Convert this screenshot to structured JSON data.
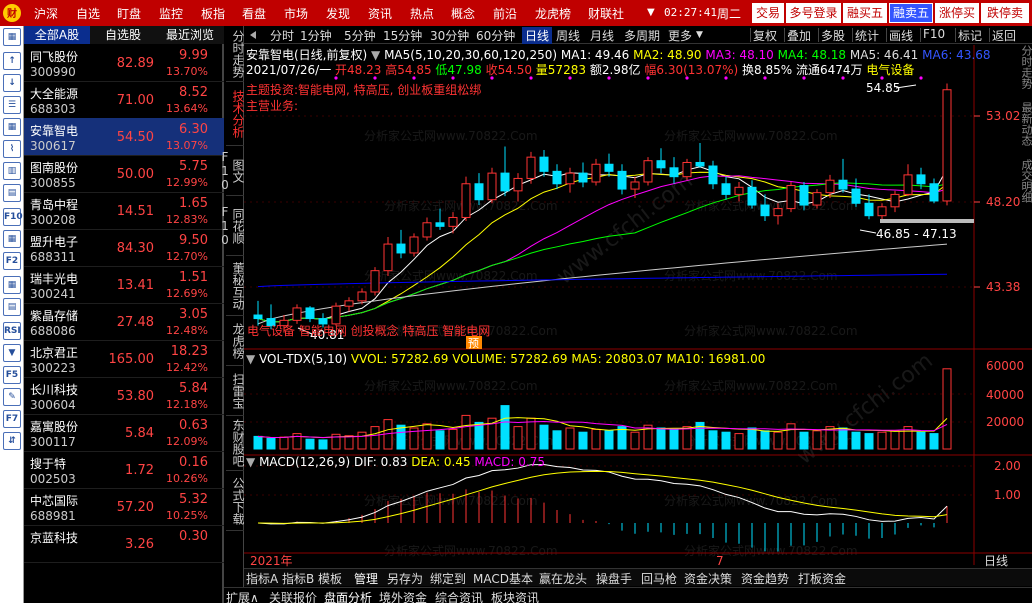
{
  "top_menu": {
    "items": [
      "沪深",
      "自选",
      "盯盘",
      "监控",
      "板指",
      "看盘",
      "市场",
      "发现",
      "资讯",
      "热点",
      "概念",
      "前沿",
      "龙虎榜",
      "财联社"
    ],
    "dropdown_arrow": "▼",
    "clock": "02:27:41",
    "weekday": "周二",
    "buttons": [
      "交易",
      "多号登录",
      "融买五",
      "融卖五",
      "涨停买",
      "跌停卖"
    ]
  },
  "left_icons": [
    "grid-icon",
    "arrow-up-icon",
    "arrow-down-icon",
    "list-icon",
    "grid2-icon",
    "line-chart-icon",
    "candle-icon",
    "bars-icon",
    "f10-icon",
    "grid3-icon",
    "f2-icon",
    "grid4-icon",
    "doc-icon",
    "rsi-icon",
    "flag-icon",
    "f5-icon",
    "pencil-icon",
    "f7-icon",
    "arrow-icon"
  ],
  "left_icon_labels": [
    "▦",
    "↑",
    "↓",
    "☰",
    "▦",
    "⌇",
    "▥",
    "▤",
    "F10",
    "▦",
    "F2",
    "▦",
    "▤",
    "RSI",
    "▼",
    "F5",
    "✎",
    "F7",
    "⇵"
  ],
  "stock_list": {
    "tabs": [
      "全部A股",
      "自选股",
      "最近浏览"
    ],
    "rows": [
      {
        "name": "同飞股份",
        "code": "300990",
        "price": "82.89",
        "change": "9.99",
        "pct": "13.70%"
      },
      {
        "name": "大全能源",
        "code": "688303",
        "price": "71.00",
        "change": "8.52",
        "pct": "13.64%"
      },
      {
        "name": "安靠智电",
        "code": "300617",
        "price": "54.50",
        "change": "6.30",
        "pct": "13.07%"
      },
      {
        "name": "图南股份",
        "code": "300855",
        "price": "50.00",
        "change": "5.75",
        "pct": "12.99%"
      },
      {
        "name": "青岛中程",
        "code": "300208",
        "price": "14.51",
        "change": "1.65",
        "pct": "12.83%"
      },
      {
        "name": "盟升电子",
        "code": "688311",
        "price": "84.30",
        "change": "9.50",
        "pct": "12.70%"
      },
      {
        "name": "瑞丰光电",
        "code": "300241",
        "price": "13.41",
        "change": "1.51",
        "pct": "12.69%"
      },
      {
        "name": "紫晶存储",
        "code": "688086",
        "price": "27.48",
        "change": "3.05",
        "pct": "12.48%"
      },
      {
        "name": "北京君正",
        "code": "300223",
        "price": "165.00",
        "change": "18.23",
        "pct": "12.42%"
      },
      {
        "name": "长川科技",
        "code": "300604",
        "price": "53.80",
        "change": "5.84",
        "pct": "12.18%"
      },
      {
        "name": "嘉寓股份",
        "code": "300117",
        "price": "5.84",
        "change": "0.63",
        "pct": "12.09%"
      },
      {
        "name": "搜于特",
        "code": "002503",
        "price": "1.72",
        "change": "0.16",
        "pct": "10.26%"
      },
      {
        "name": "中芯国际",
        "code": "688981",
        "price": "57.20",
        "change": "5.32",
        "pct": "10.25%"
      },
      {
        "name": "京蓝科技",
        "code": "",
        "price": "3.26",
        "change": "0.30",
        "pct": ""
      }
    ]
  },
  "side_tabs": [
    "分时走势",
    "技术分析",
    "图文F10",
    "同花顺F10",
    "董秘互动",
    "龙虎榜",
    "扫雷宝",
    "东财股吧",
    "公式下载"
  ],
  "period_bar": {
    "periods": [
      "分时",
      "1分钟",
      "5分钟",
      "15分钟",
      "30分钟",
      "60分钟",
      "日线",
      "周线",
      "月线",
      "多周期",
      "更多"
    ],
    "tools": [
      "复权",
      "叠加",
      "多股",
      "统计",
      "画线",
      "F10",
      "标记",
      "返回"
    ]
  },
  "chart_header": {
    "title": "安靠智电(日线,前复权)",
    "ma_label": "MA5(5,10,20,30,60,120,250)",
    "ma_values": [
      "MA1: 49.46",
      "MA2: 48.90",
      "MA3: 48.10",
      "MA4: 48.18",
      "MA5: 46.41",
      "MA6: 43.68"
    ],
    "info_date": "2021/07/26/一",
    "info_open": "开48.23",
    "info_high": "高54.85",
    "info_low": "低47.98",
    "info_close": "收54.50",
    "info_volume": "量57283",
    "info_amount": "额2.98亿",
    "info_change": "幅6.30(13.07%)",
    "info_turnover": "换8.85%",
    "info_float": "流通6474万",
    "info_sector": "电气设备",
    "note1": "主题投资:智能电网, 特高压, 创业板重组松绑",
    "note2": "主营业务:",
    "price_high_label": "54.85",
    "price_low_label": "40.81",
    "range_label": "46.85 - 47.13",
    "concept_tags": "电气设备 智能电网 创投概念 特高压 智能电网",
    "pre_badge": "预",
    "y_axis_main": [
      "53.02",
      "48.20",
      "43.38"
    ],
    "vol_label": "VOL-TDX(5,10)",
    "vol_values": "VVOL: 57282.69  VOLUME: 57282.69  MA5: 20803.07  MA10: 16981.00",
    "y_axis_vol": [
      "60000",
      "40000",
      "20000"
    ],
    "macd_label": "MACD(12,26,9)",
    "macd_dif": "DIF: 0.83",
    "macd_dea": "DEA: 0.45",
    "macd_val": "MACD: 0.75",
    "y_axis_macd": [
      "2.00",
      "1.00"
    ],
    "x_labels": [
      "2021年",
      "7"
    ],
    "period_label": "日线",
    "plus": "+",
    "minus": "-",
    "right_vertical": "分时走势 最新动态 成交明细"
  },
  "chart_data": [
    {
      "type": "candlestick",
      "title": "安靠智电(日线,前复权)",
      "y_range": [
        40.81,
        54.85
      ],
      "y_ticks": [
        43.38,
        48.2,
        53.02
      ],
      "last_candle": {
        "date": "2021/07/26",
        "open": 48.23,
        "high": 54.85,
        "low": 47.98,
        "close": 54.5
      },
      "ohlc": [
        [
          41.8,
          42.6,
          41.2,
          41.6
        ],
        [
          41.6,
          42.4,
          41.0,
          41.2
        ],
        [
          41.2,
          41.8,
          40.81,
          41.5
        ],
        [
          41.5,
          42.4,
          41.3,
          42.2
        ],
        [
          42.2,
          42.3,
          41.4,
          41.6
        ],
        [
          41.6,
          41.9,
          41.1,
          41.3
        ],
        [
          41.3,
          42.5,
          41.2,
          42.3
        ],
        [
          42.3,
          42.8,
          42.0,
          42.6
        ],
        [
          42.6,
          43.3,
          42.4,
          43.1
        ],
        [
          43.1,
          44.5,
          42.9,
          44.3
        ],
        [
          44.3,
          46.2,
          44.0,
          45.8
        ],
        [
          45.8,
          46.6,
          45.0,
          45.3
        ],
        [
          45.3,
          46.4,
          45.1,
          46.2
        ],
        [
          46.2,
          47.3,
          46.0,
          47.0
        ],
        [
          47.0,
          47.8,
          46.6,
          46.8
        ],
        [
          46.8,
          47.6,
          46.4,
          47.3
        ],
        [
          47.3,
          49.6,
          47.1,
          49.2
        ],
        [
          49.2,
          49.8,
          48.0,
          48.3
        ],
        [
          48.3,
          50.1,
          48.1,
          49.8
        ],
        [
          49.8,
          51.3,
          48.5,
          48.8
        ],
        [
          48.8,
          49.8,
          48.2,
          49.5
        ],
        [
          49.5,
          51.0,
          49.2,
          50.7
        ],
        [
          50.7,
          51.1,
          49.6,
          49.9
        ],
        [
          49.9,
          50.3,
          48.9,
          49.2
        ],
        [
          49.2,
          50.1,
          48.7,
          49.8
        ],
        [
          49.8,
          50.4,
          49.0,
          49.3
        ],
        [
          49.3,
          50.6,
          49.1,
          50.3
        ],
        [
          50.3,
          50.9,
          49.6,
          49.9
        ],
        [
          49.9,
          50.3,
          48.6,
          48.9
        ],
        [
          48.9,
          49.6,
          48.4,
          49.3
        ],
        [
          49.3,
          50.7,
          49.1,
          50.5
        ],
        [
          50.5,
          51.2,
          49.8,
          50.1
        ],
        [
          50.1,
          50.7,
          49.2,
          49.6
        ],
        [
          49.6,
          50.6,
          49.4,
          50.4
        ],
        [
          50.4,
          51.5,
          50.1,
          50.2
        ],
        [
          50.2,
          50.5,
          48.9,
          49.2
        ],
        [
          49.2,
          49.6,
          48.3,
          48.6
        ],
        [
          48.6,
          49.3,
          48.2,
          49.0
        ],
        [
          49.0,
          49.4,
          47.8,
          48.0
        ],
        [
          48.0,
          48.6,
          47.1,
          47.4
        ],
        [
          47.4,
          48.1,
          46.9,
          47.8
        ],
        [
          47.8,
          49.3,
          47.6,
          49.1
        ],
        [
          49.1,
          49.3,
          47.7,
          48.0
        ],
        [
          48.0,
          48.9,
          47.8,
          48.7
        ],
        [
          48.7,
          49.7,
          48.4,
          49.4
        ],
        [
          49.4,
          50.6,
          48.7,
          48.9
        ],
        [
          48.9,
          49.5,
          47.9,
          48.1
        ],
        [
          48.1,
          48.6,
          47.2,
          47.4
        ],
        [
          47.4,
          48.1,
          47.1,
          47.9
        ],
        [
          47.9,
          48.8,
          47.6,
          48.6
        ],
        [
          48.6,
          50.3,
          48.5,
          49.7
        ],
        [
          49.7,
          50.1,
          48.9,
          49.2
        ],
        [
          49.2,
          49.5,
          48.1,
          48.23
        ],
        [
          48.23,
          54.85,
          47.98,
          54.5
        ]
      ]
    },
    {
      "type": "bar",
      "title": "VOL-TDX(5,10)",
      "y_range": [
        0,
        60000
      ],
      "y_ticks": [
        20000,
        40000,
        60000
      ],
      "values": [
        9000,
        7500,
        8500,
        11000,
        7000,
        6500,
        10500,
        9500,
        12000,
        16000,
        21000,
        17000,
        15000,
        18000,
        13000,
        14000,
        24000,
        19000,
        22000,
        31000,
        16000,
        22000,
        17000,
        13000,
        15000,
        12000,
        14000,
        13000,
        16000,
        12000,
        17000,
        15000,
        14000,
        16000,
        19000,
        13000,
        12000,
        11000,
        15000,
        13000,
        12000,
        18000,
        12000,
        13000,
        16000,
        15000,
        12000,
        11000,
        12000,
        13000,
        16000,
        12000,
        11000,
        57283
      ],
      "ma5_last": 20803.07,
      "ma10_last": 16981.0
    },
    {
      "type": "bar",
      "title": "MACD(12,26,9)",
      "y_range": [
        -2.2,
        2.2
      ],
      "y_ticks": [
        1.0,
        2.0
      ],
      "dif_last": 0.83,
      "dea_last": 0.45,
      "macd_last": 0.75
    }
  ],
  "bottom_tabs": [
    "指标A",
    "指标B",
    "模板",
    "管理",
    "另存为",
    "绑定到",
    "MACD基本",
    "赢在龙头",
    "操盘手",
    "回马枪",
    "资金决策",
    "资金趋势",
    "打板资金"
  ],
  "status_tabs": [
    "扩展∧",
    "关联报价",
    "盘面分析",
    "境外资金",
    "综合资讯",
    "板块资讯"
  ],
  "colors": {
    "up": "#ff3333",
    "down": "#00e0ff",
    "ma5": "#ffffff",
    "ma10": "#ffff00",
    "ma20": "#ff00ff",
    "ma30": "#00ff00",
    "ma60": "#cccccc",
    "ma120": "#0000ff",
    "top_bar": "#c00000",
    "selected_row": "#15307a"
  }
}
